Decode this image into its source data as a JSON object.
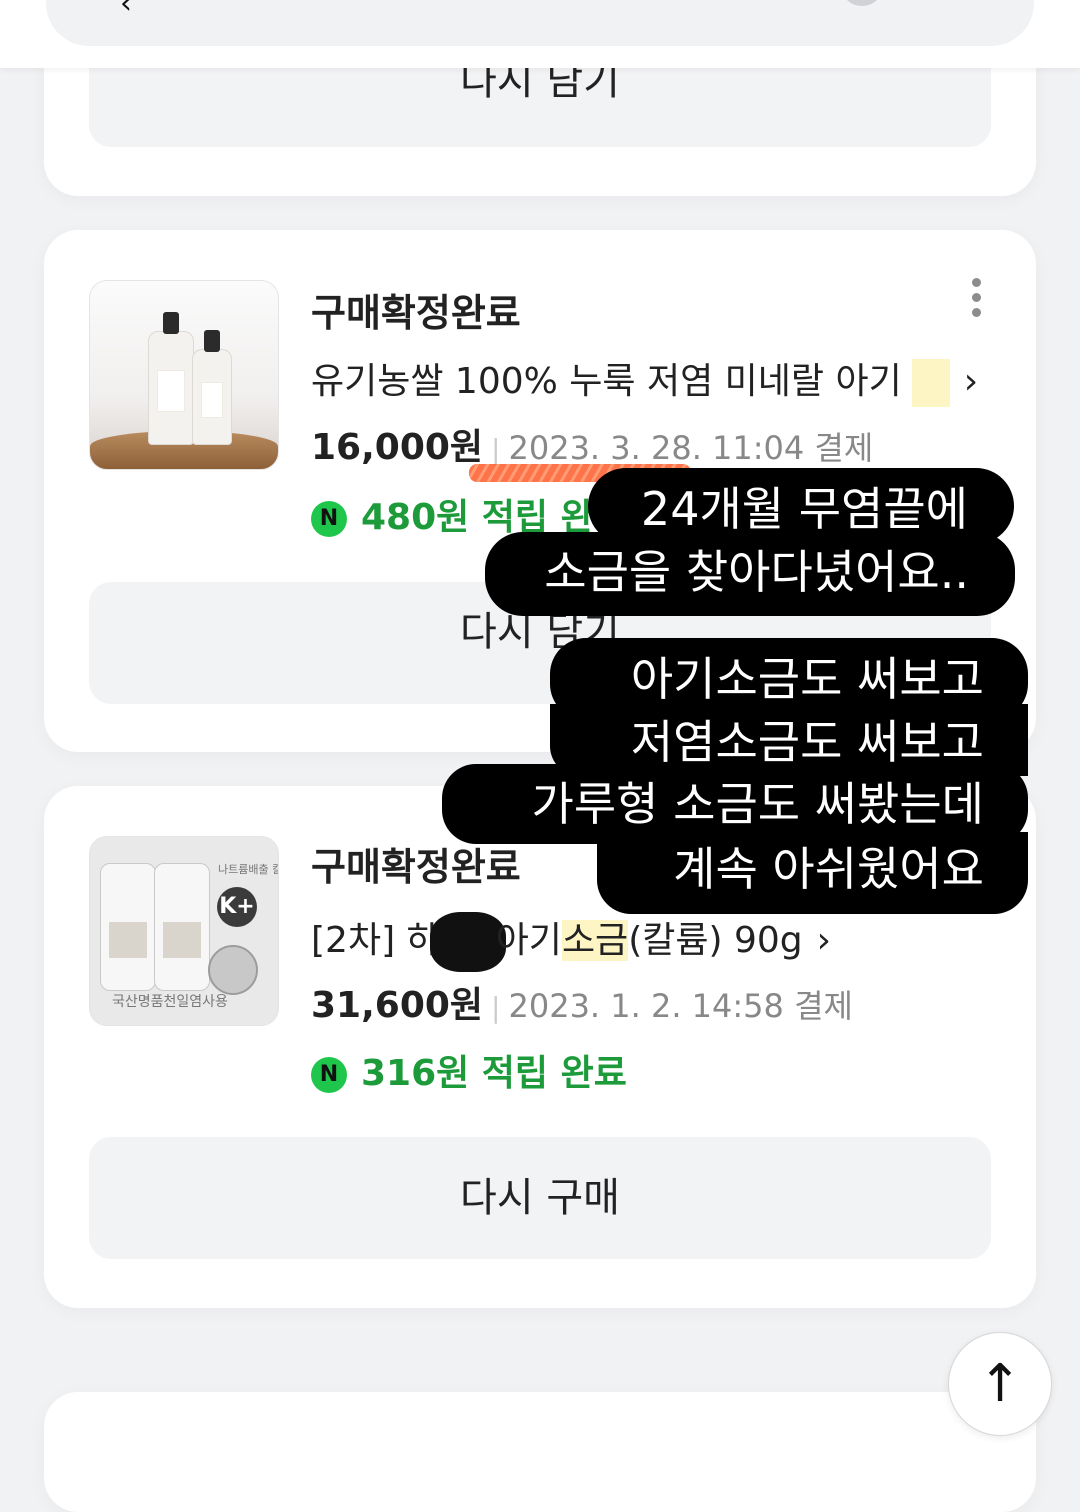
{
  "header": {
    "back_icon": "chevron-left-icon"
  },
  "orders": [
    {
      "action_label": "다시 담기"
    },
    {
      "status": "구매확정완료",
      "product_name": "유기농쌀 100% 누룩 저염 미네랄 아기",
      "price": "16,000원",
      "date": "2023. 3. 28. 11:04 결제",
      "reward": "480원 적립 완",
      "action_label": "다시 담기"
    },
    {
      "status": "구매확정완료",
      "product_prefix": "[2차] 하",
      "product_mid": "아기",
      "product_highlight": "소금",
      "product_suffix": "(칼륨) 90g",
      "price": "31,600원",
      "date": "2023. 1. 2. 14:58 결제",
      "reward": "316원 적립 완료",
      "action_label": "다시 구매",
      "thumb_badge": "나트륨배출 칼륨함유",
      "thumb_k": "K+",
      "thumb_caption": "국산명품천일염사용"
    }
  ],
  "npay_icon_text": "N",
  "overlay": {
    "line1": "24개월 무염끝에",
    "line2": "소금을 찾아다녔어요..",
    "line3": "아기소금도 써보고",
    "line4": "저염소금도 써보고",
    "line5": "가루형 소금도 써봤는데",
    "line6": "계속 아쉬웠어요"
  },
  "scroll_top_icon": "arrow-up-icon",
  "colors": {
    "reward_green": "#1d9b3b",
    "npay_green": "#1ec74b",
    "highlight": "#fdf6c4"
  }
}
